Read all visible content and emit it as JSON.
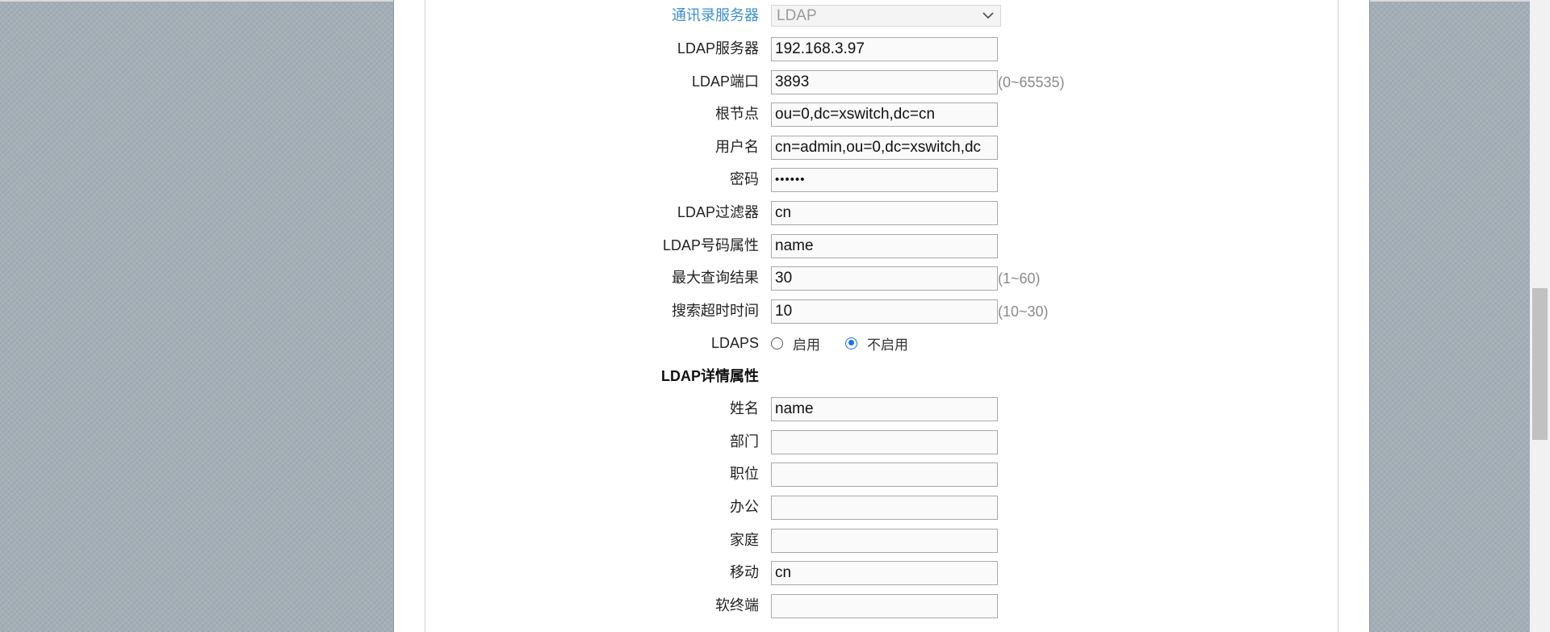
{
  "form": {
    "directory_server": {
      "label": "通讯录服务器",
      "value": "LDAP"
    },
    "ldap_server": {
      "label": "LDAP服务器",
      "value": "192.168.3.97"
    },
    "ldap_port": {
      "label": "LDAP端口",
      "value": "3893",
      "hint": "(0~65535)"
    },
    "root_node": {
      "label": "根节点",
      "value": "ou=0,dc=xswitch,dc=cn"
    },
    "username": {
      "label": "用户名",
      "value": "cn=admin,ou=0,dc=xswitch,dc"
    },
    "password": {
      "label": "密码",
      "value": "••••••"
    },
    "ldap_filter": {
      "label": "LDAP过滤器",
      "value": "cn"
    },
    "ldap_number_attr": {
      "label": "LDAP号码属性",
      "value": "name"
    },
    "max_results": {
      "label": "最大查询结果",
      "value": "30",
      "hint": "(1~60)"
    },
    "search_timeout": {
      "label": "搜索超时时间",
      "value": "10",
      "hint": "(10~30)"
    },
    "ldaps": {
      "label": "LDAPS",
      "options": [
        "启用",
        "不启用"
      ],
      "selected": "不启用"
    }
  },
  "details": {
    "section_title": "LDAP详情属性",
    "name": {
      "label": "姓名",
      "value": "name"
    },
    "department": {
      "label": "部门",
      "value": ""
    },
    "position": {
      "label": "职位",
      "value": ""
    },
    "office": {
      "label": "办公",
      "value": ""
    },
    "home": {
      "label": "家庭",
      "value": ""
    },
    "mobile": {
      "label": "移动",
      "value": "cn"
    },
    "softphone": {
      "label": "软终端",
      "value": ""
    }
  },
  "colors": {
    "accent_label": "#3b8fd0",
    "radio_checked": "#1a73e8",
    "background": "#a3aeb6"
  }
}
